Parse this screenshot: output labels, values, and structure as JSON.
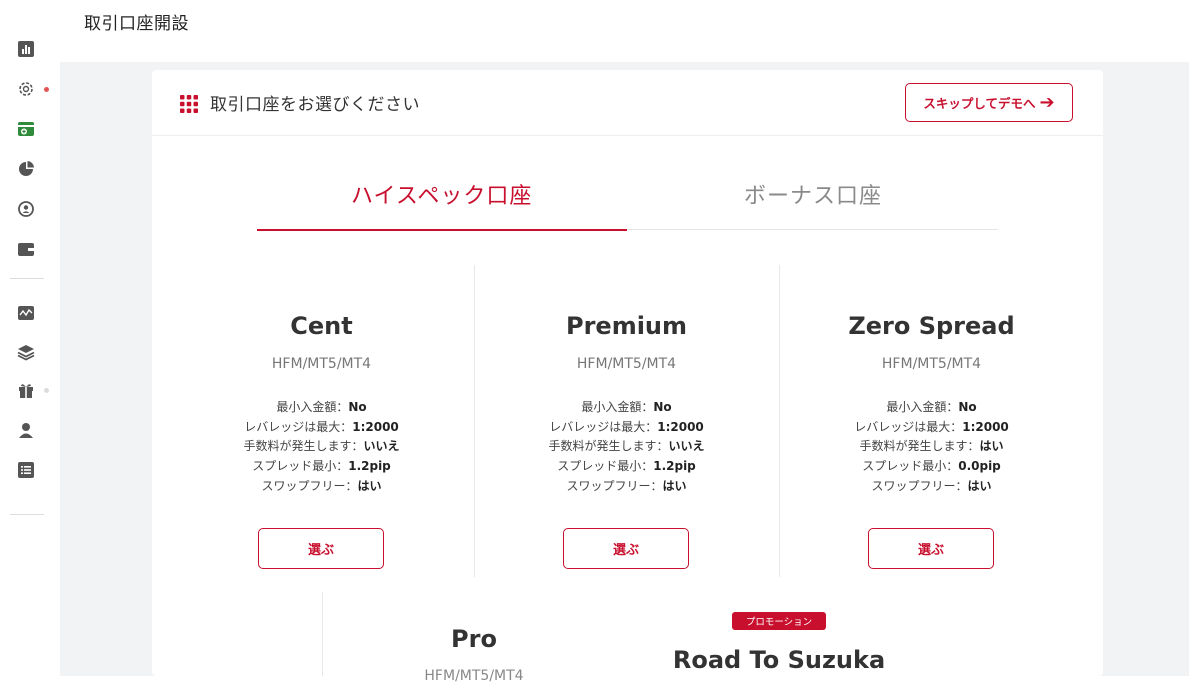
{
  "page": {
    "title": "取引口座開設"
  },
  "sidebar": {
    "icons": [
      "bar-chart-icon",
      "gear-icon",
      "add-account-icon",
      "pie-chart-icon",
      "user-circle-icon",
      "wallet-icon",
      "line-chart-icon",
      "layers-icon",
      "gift-icon",
      "person-icon",
      "list-icon"
    ]
  },
  "header": {
    "title": "取引口座をお選びください",
    "skip_label": "スキップしてデモへ"
  },
  "tabs": [
    {
      "label": "ハイスペック口座",
      "active": true
    },
    {
      "label": "ボーナス口座",
      "active": false
    }
  ],
  "plans": [
    {
      "name": "Cent",
      "platform": "HFM/MT5/MT4",
      "specs": [
        {
          "label": "最小入金額：",
          "value": "No"
        },
        {
          "label": "レバレッジは最大：",
          "value": "1:2000"
        },
        {
          "label": "手数料が発生します：",
          "value": "いいえ"
        },
        {
          "label": "スプレッド最小：",
          "value": "1.2pip"
        },
        {
          "label": "スワップフリー：",
          "value": "はい"
        }
      ],
      "button": "選ぶ"
    },
    {
      "name": "Premium",
      "platform": "HFM/MT5/MT4",
      "specs": [
        {
          "label": "最小入金額：",
          "value": "No"
        },
        {
          "label": "レバレッジは最大：",
          "value": "1:2000"
        },
        {
          "label": "手数料が発生します：",
          "value": "いいえ"
        },
        {
          "label": "スプレッド最小：",
          "value": "1.2pip"
        },
        {
          "label": "スワップフリー：",
          "value": "はい"
        }
      ],
      "button": "選ぶ"
    },
    {
      "name": "Zero Spread",
      "platform": "HFM/MT5/MT4",
      "specs": [
        {
          "label": "最小入金額：",
          "value": "No"
        },
        {
          "label": "レバレッジは最大：",
          "value": "1:2000"
        },
        {
          "label": "手数料が発生します：",
          "value": "はい"
        },
        {
          "label": "スプレッド最小：",
          "value": "0.0pip"
        },
        {
          "label": "スワップフリー：",
          "value": "はい"
        }
      ],
      "button": "選ぶ"
    }
  ],
  "bottom_plans": [
    {
      "name": "Pro",
      "platform": "HFM/MT5/MT4"
    },
    {
      "name": "Road To Suzuka",
      "badge": "プロモーション"
    }
  ],
  "colors": {
    "accent": "#c8102e",
    "background": "#f2f3f5"
  }
}
